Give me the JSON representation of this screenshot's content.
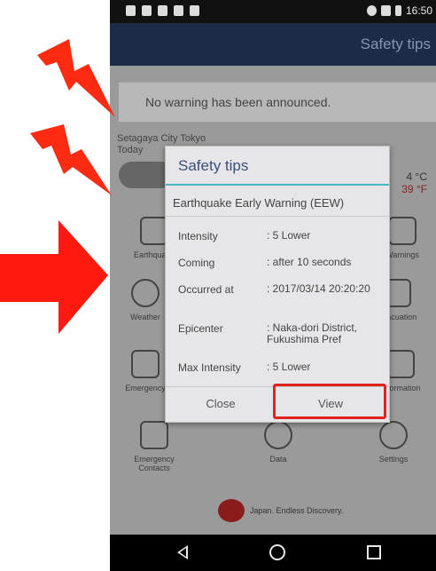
{
  "status_bar": {
    "time": "16:50"
  },
  "app_bar": {
    "title": "Safety tips"
  },
  "home": {
    "warning": "No warning has been announced.",
    "city": "Setagaya City Tokyo",
    "today": "Today",
    "temp_c": "4 °C",
    "temp_f": "39 °F",
    "tiles": [
      {
        "label": "Earthquake",
        "icon": "building-icon"
      },
      {
        "label": "Warnings",
        "icon": "warning-icon"
      },
      {
        "label": "Weather",
        "icon": "sun-icon"
      },
      {
        "label": "Evacuation",
        "icon": "sign-icon"
      },
      {
        "label": "Emergency",
        "icon": "house-icon"
      },
      {
        "label": "Information",
        "icon": "chat-icon"
      },
      {
        "label": "Emergency Contacts",
        "icon": "contacts-icon"
      },
      {
        "label": "Data",
        "icon": "info-icon"
      },
      {
        "label": "Settings",
        "icon": "gear-icon"
      }
    ],
    "logo_text": "Japan. Endless Discovery."
  },
  "dialog": {
    "title": "Safety tips",
    "subtitle": "Earthquake Early Warning (EEW)",
    "rows": [
      {
        "label": "Intensity",
        "value": ": 5 Lower"
      },
      {
        "label": "Coming",
        "value": ": after 10 seconds"
      },
      {
        "label": "Occurred at",
        "value": ": 2017/03/14 20:20:20"
      },
      {
        "label": "Epicenter",
        "value": ": Naka-dori District, Fukushima Pref"
      },
      {
        "label": "Max Intensity",
        "value": ": 5 Lower"
      }
    ],
    "close_label": "Close",
    "view_label": "View"
  },
  "colors": {
    "alert_red": "#e0231f",
    "app_bar": "#1c2b46",
    "dialog_title": "#3a4f7a",
    "dialog_rule": "#4fb3c8"
  },
  "icons": [
    "lightning-bolt-icon",
    "right-arrow-icon",
    "back-icon",
    "home-icon",
    "recents-icon"
  ]
}
